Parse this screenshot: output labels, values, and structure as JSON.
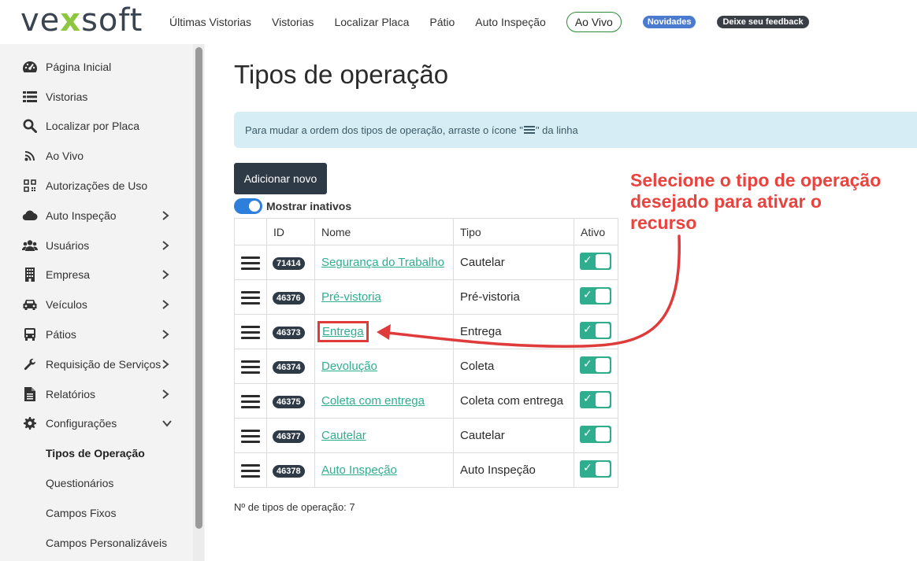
{
  "brand": {
    "logo_pre": "ve",
    "logo_x": "x",
    "logo_post": "soft"
  },
  "topnav": {
    "items": [
      "Últimas Vistorias",
      "Vistorias",
      "Localizar Placa",
      "Pátio",
      "Auto Inspeção"
    ],
    "live": "Ao Vivo",
    "news_badge": "Novidades",
    "feedback_badge": "Deixe seu feedback"
  },
  "sidebar": {
    "items": [
      {
        "label": "Página Inicial",
        "icon": "dashboard-icon"
      },
      {
        "label": "Vistorias",
        "icon": "list-icon"
      },
      {
        "label": "Localizar por Placa",
        "icon": "search-icon"
      },
      {
        "label": "Ao Vivo",
        "icon": "rss-icon"
      },
      {
        "label": "Autorizações de Uso",
        "icon": "qrcode-icon"
      },
      {
        "label": "Auto Inspeção",
        "icon": "cloud-icon"
      },
      {
        "label": "Usuários",
        "icon": "users-icon"
      },
      {
        "label": "Empresa",
        "icon": "building-icon"
      },
      {
        "label": "Veículos",
        "icon": "car-icon"
      },
      {
        "label": "Pátios",
        "icon": "bus-icon"
      },
      {
        "label": "Requisição de Serviços",
        "icon": "wrench-icon"
      },
      {
        "label": "Relatórios",
        "icon": "file-icon"
      },
      {
        "label": "Configurações",
        "icon": "gear-icon"
      }
    ],
    "sub_items": [
      "Tipos de Operação",
      "Questionários",
      "Campos Fixos",
      "Campos Personalizáveis"
    ],
    "active_sub": "Tipos de Operação"
  },
  "main": {
    "title": "Tipos de operação",
    "info_pre": "Para mudar a ordem dos tipos de operação, arraste o ícone \"",
    "info_post": "\" da linha",
    "add_button": "Adicionar novo",
    "show_inactive_label": "Mostrar inativos",
    "show_inactive": true,
    "table": {
      "headers": [
        "ID",
        "Nome",
        "Tipo",
        "Ativo"
      ],
      "rows": [
        {
          "id": "71414",
          "name": "Segurança do Trabalho",
          "type": "Cautelar",
          "active": true
        },
        {
          "id": "46376",
          "name": "Pré-vistoria",
          "type": "Pré-vistoria",
          "active": true
        },
        {
          "id": "46373",
          "name": "Entrega",
          "type": "Entrega",
          "active": true
        },
        {
          "id": "46374",
          "name": "Devolução",
          "type": "Coleta",
          "active": true
        },
        {
          "id": "46375",
          "name": "Coleta com entrega",
          "type": "Coleta com entrega",
          "active": true
        },
        {
          "id": "46377",
          "name": "Cautelar",
          "type": "Cautelar",
          "active": true
        },
        {
          "id": "46378",
          "name": "Auto Inspeção",
          "type": "Auto Inspeção",
          "active": true
        }
      ]
    },
    "count_label": "Nº de tipos de operação: 7"
  },
  "annotation": {
    "lines": [
      "Selecione o tipo de operação",
      "desejado para ativar o",
      "recurso"
    ],
    "color": "#e8433f"
  },
  "colors": {
    "accent": "#2fae91",
    "dark": "#2f3a47",
    "info_bg": "#d7edf5",
    "highlight": "#e03b3b"
  }
}
